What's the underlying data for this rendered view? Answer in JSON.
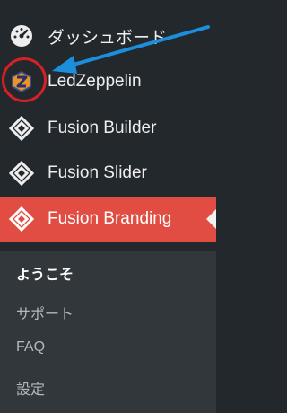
{
  "menu": {
    "items": [
      {
        "label": "ダッシュボード",
        "icon": "dashboard-icon"
      },
      {
        "label": "LedZeppelin",
        "icon": "ledzeppelin-logo-icon"
      },
      {
        "label": "Fusion Builder",
        "icon": "fusion-icon"
      },
      {
        "label": "Fusion Slider",
        "icon": "fusion-icon"
      },
      {
        "label": "Fusion Branding",
        "icon": "fusion-icon",
        "active": true
      }
    ]
  },
  "submenu": {
    "items": [
      {
        "label": "ようこそ",
        "current": true
      },
      {
        "label": "サポート"
      },
      {
        "label": "FAQ"
      },
      {
        "label": "設定"
      }
    ]
  },
  "colors": {
    "background": "#23282d",
    "submenu_background": "#32373c",
    "active": "#e14d43",
    "annotation_circle": "#d42026",
    "annotation_arrow": "#1b8fdb"
  }
}
